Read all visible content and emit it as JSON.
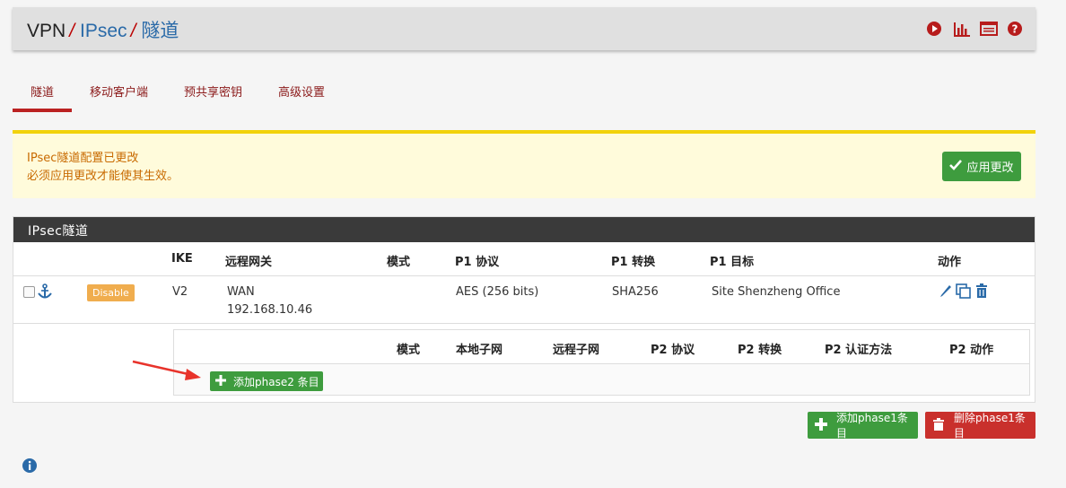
{
  "breadcrumb": {
    "c1": "VPN",
    "c2": "IPsec",
    "c3": "隧道"
  },
  "header_icons": [
    "play-circle-icon",
    "bar-chart-icon",
    "list-icon",
    "help-icon"
  ],
  "tabs": [
    {
      "label": "隧道",
      "active": true
    },
    {
      "label": "移动客户端"
    },
    {
      "label": "预共享密钥"
    },
    {
      "label": "高级设置"
    }
  ],
  "warning": {
    "line1": "IPsec隧道配置已更改",
    "line2": "必须应用更改才能使其生效。",
    "apply_label": "应用更改"
  },
  "panel": {
    "title": "IPsec隧道",
    "p1_headers": {
      "ike": "IKE",
      "gateway": "远程网关",
      "mode": "模式",
      "protocol": "P1 协议",
      "transform": "P1 转换",
      "target": "P1 目标",
      "actions": "动作"
    },
    "p1_row": {
      "status_badge": "Disable",
      "ike": "V2",
      "gateway_iface": "WAN",
      "gateway_ip": "192.168.10.46",
      "protocol": "AES (256 bits)",
      "transform": "SHA256",
      "target": "Site Shenzheng Office"
    },
    "p2_headers": {
      "mode": "模式",
      "local": "本地子网",
      "remote": "远程子网",
      "protocol": "P2 协议",
      "transform": "P2 转换",
      "auth": "P2 认证方法",
      "actions": "P2 动作"
    },
    "add_p2_label": "添加phase2 条目"
  },
  "footer": {
    "add_p1_label": "添加phase1条目",
    "delete_p1_label": "删除phase1条目"
  },
  "colors": {
    "link": "#2a6aa8",
    "danger": "#c9302c",
    "success": "#3e9c3e",
    "warning_bg": "#fffbdb",
    "warning_border": "#f2d20a"
  }
}
